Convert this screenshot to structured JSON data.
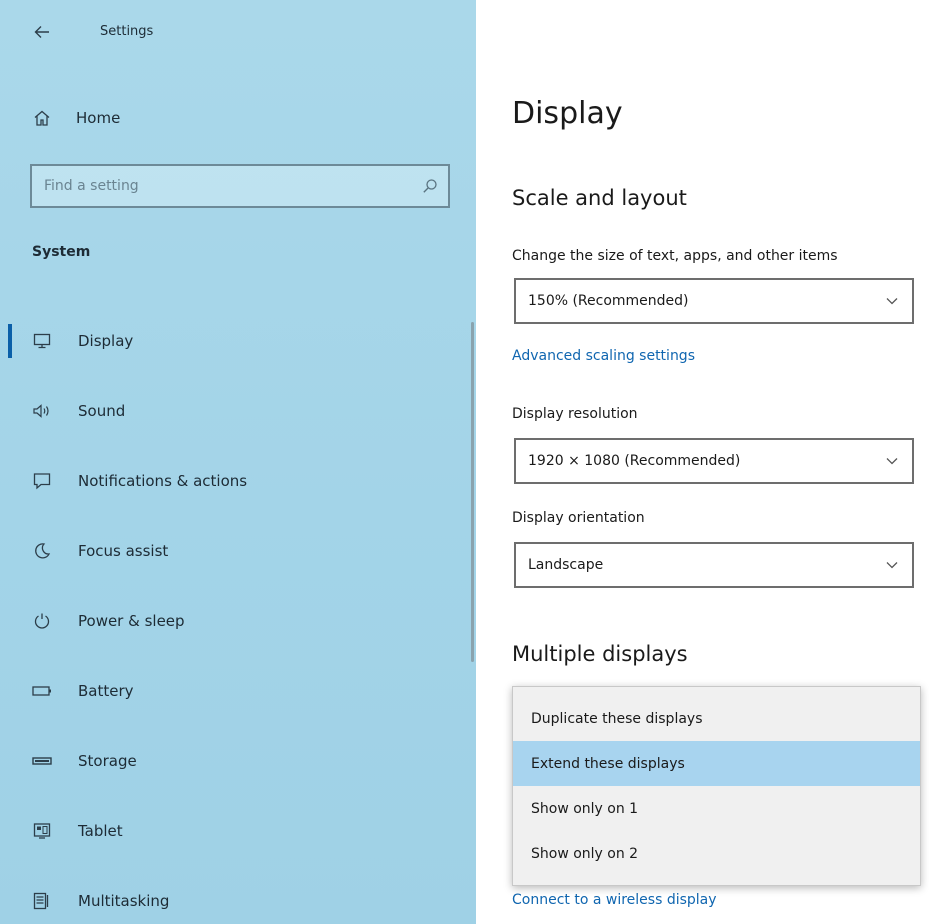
{
  "window": {
    "title": "Settings"
  },
  "sidebar": {
    "home_label": "Home",
    "search": {
      "placeholder": "Find a setting",
      "value": ""
    },
    "section_label": "System",
    "items": [
      {
        "label": "Display",
        "icon": "monitor-icon",
        "active": true
      },
      {
        "label": "Sound",
        "icon": "speaker-icon",
        "active": false
      },
      {
        "label": "Notifications & actions",
        "icon": "notification-icon",
        "active": false
      },
      {
        "label": "Focus assist",
        "icon": "moon-icon",
        "active": false
      },
      {
        "label": "Power & sleep",
        "icon": "power-icon",
        "active": false
      },
      {
        "label": "Battery",
        "icon": "battery-icon",
        "active": false
      },
      {
        "label": "Storage",
        "icon": "storage-icon",
        "active": false
      },
      {
        "label": "Tablet",
        "icon": "tablet-icon",
        "active": false
      },
      {
        "label": "Multitasking",
        "icon": "multitasking-icon",
        "active": false
      }
    ]
  },
  "main": {
    "title": "Display",
    "scale_section": {
      "title": "Scale and layout",
      "scale_label": "Change the size of text, apps, and other items",
      "scale_value": "150% (Recommended)",
      "advanced_link": "Advanced scaling settings",
      "resolution_label": "Display resolution",
      "resolution_value": "1920 × 1080 (Recommended)",
      "orientation_label": "Display orientation",
      "orientation_value": "Landscape"
    },
    "multiple_section": {
      "title": "Multiple displays",
      "options": [
        {
          "label": "Duplicate these displays",
          "selected": false
        },
        {
          "label": "Extend these displays",
          "selected": true
        },
        {
          "label": "Show only on 1",
          "selected": false
        },
        {
          "label": "Show only on 2",
          "selected": false
        }
      ],
      "wireless_link": "Connect to a wireless display"
    }
  },
  "colors": {
    "sidebar_bg": "#a6d6e9",
    "accent": "#0a5fa8",
    "link": "#1066b0",
    "selected_option": "#a8d4ef"
  }
}
